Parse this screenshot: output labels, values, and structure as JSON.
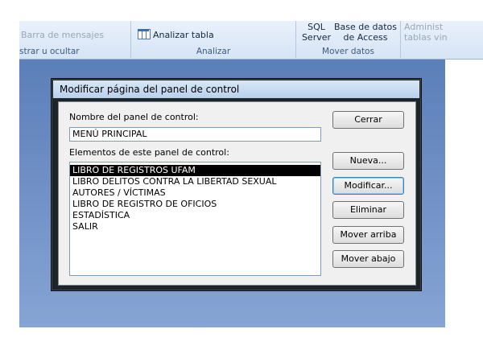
{
  "ribbon": {
    "barra_label": "Barra de mensajes",
    "group1_caption": "strar u ocultar",
    "analizar_btn": "Analizar tabla",
    "group2_caption": "Analizar",
    "sql_line1": "SQL",
    "sql_line2": "Server",
    "access_line1": "Base de datos",
    "access_line2": "de Access",
    "group3_caption": "Mover datos",
    "admin_line1": "Administ",
    "admin_line2": "tablas vin"
  },
  "dialog": {
    "title": "Modificar página del panel de control",
    "name_label": "Nombre del panel de control:",
    "name_value": "MENÚ PRINCIPAL",
    "items_label": "Elementos de este panel de control:",
    "items": [
      "LIBRO DE REGISTROS UFAM",
      "LIBRO DELITOS CONTRA LA LIBERTAD SEXUAL",
      "AUTORES / VÍCTIMAS",
      "LIBRO DE REGISTRO DE OFICIOS",
      "ESTADÍSTICA",
      "SALIR"
    ],
    "selected_index": 0,
    "buttons": {
      "cerrar": "Cerrar",
      "nueva": "Nueva...",
      "modificar": "Modificar...",
      "eliminar": "Eliminar",
      "arriba": "Mover arriba",
      "abajo": "Mover abajo"
    }
  }
}
